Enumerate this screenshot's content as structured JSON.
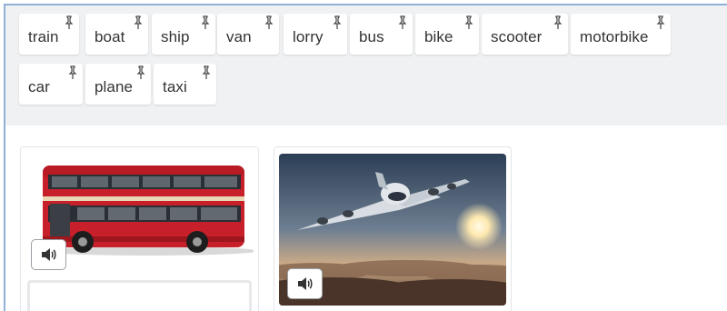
{
  "word_bank": {
    "chips": [
      {
        "label": "train"
      },
      {
        "label": "boat"
      },
      {
        "label": "ship"
      },
      {
        "label": "van"
      },
      {
        "label": "lorry"
      },
      {
        "label": "bus"
      },
      {
        "label": "bike"
      },
      {
        "label": "scooter"
      },
      {
        "label": "motorbike"
      },
      {
        "label": "car"
      },
      {
        "label": "plane"
      },
      {
        "label": "taxi"
      }
    ],
    "chip_icon": "pin-icon"
  },
  "cards": [
    {
      "image": "red-double-decker-bus",
      "audio_icon": "speaker-icon"
    },
    {
      "image": "airplane-above-clouds",
      "audio_icon": "speaker-icon"
    }
  ],
  "colors": {
    "word_bank_bg": "#eff1f3",
    "frame_border": "#8fb1d8",
    "bus_red": "#c8202a"
  }
}
